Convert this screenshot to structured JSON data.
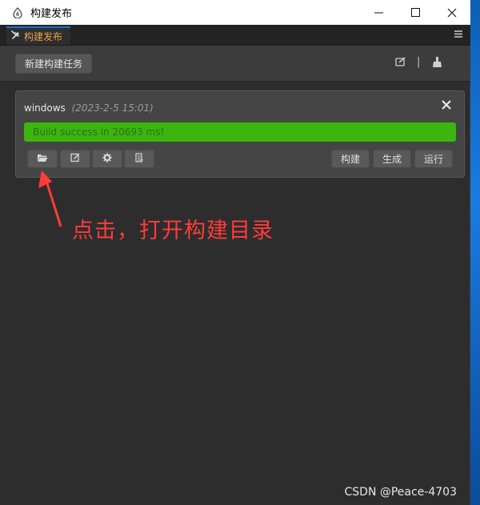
{
  "window": {
    "title": "构建发布",
    "controls": {
      "minimize": "—",
      "maximize": "☐",
      "close": "✕"
    }
  },
  "tabstrip": {
    "tab_label": "构建发布",
    "menu_icon": "☰"
  },
  "toolbar": {
    "new_task_label": "新建构建任务",
    "separator": "|"
  },
  "card": {
    "platform": "windows",
    "date": "(2023-2-5 15:01)",
    "progress": {
      "text": "Build success in 20693 ms!",
      "percent": 100
    },
    "actions": [
      "构建",
      "生成",
      "运行"
    ],
    "icon_buttons": [
      "folder-open-icon",
      "edit-icon",
      "gear-icon",
      "file-icon"
    ]
  },
  "annotation": {
    "text": "点击，打开构建目录"
  },
  "watermark": "CSDN @Peace-4703",
  "colors": {
    "accent_orange": "#e8a24a",
    "success_green": "#3cb50f",
    "annotation_red": "#ff3b3b",
    "desktop_blue": "#1f6fd0"
  }
}
